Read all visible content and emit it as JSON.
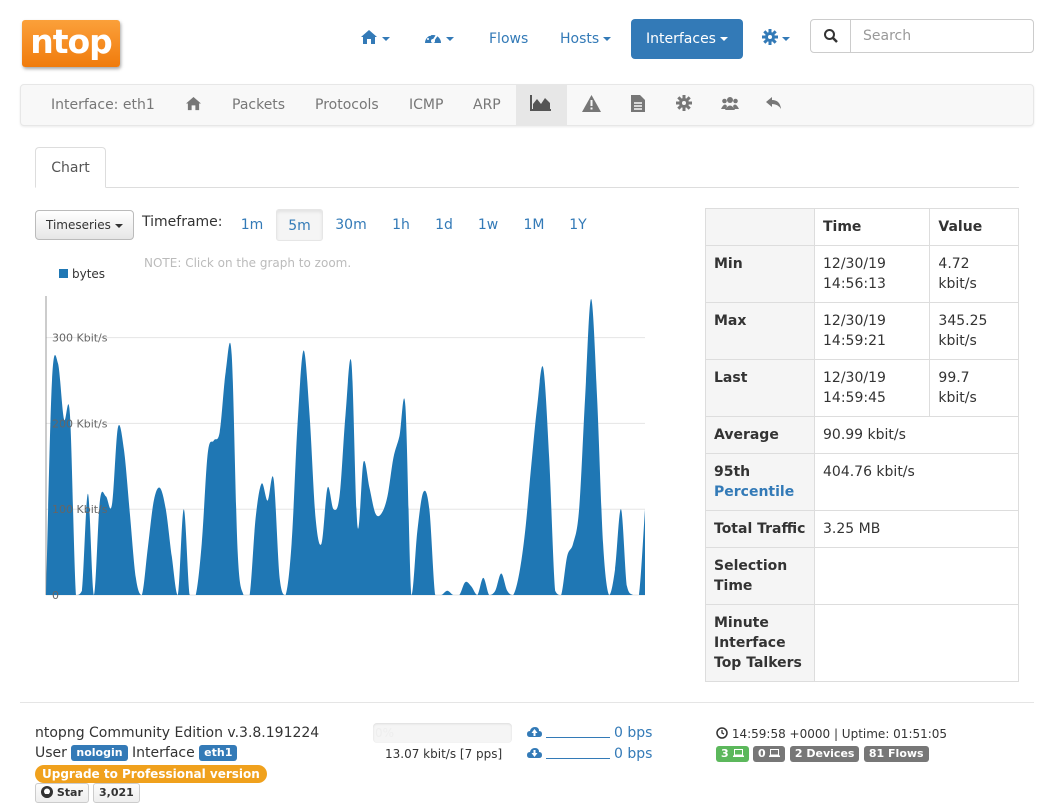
{
  "app": {
    "logo_text": "ntop"
  },
  "navbar": {
    "flows": "Flows",
    "hosts": "Hosts",
    "interfaces": "Interfaces",
    "search_placeholder": "Search"
  },
  "subnav": {
    "interface_label": "Interface: eth1",
    "packets": "Packets",
    "protocols": "Protocols",
    "icmp": "ICMP",
    "arp": "ARP"
  },
  "tabs": {
    "chart": "Chart"
  },
  "controls": {
    "timeseries": "Timeseries",
    "timeframe_label": "Timeframe:",
    "timeframes": [
      "1m",
      "5m",
      "30m",
      "1h",
      "1d",
      "1w",
      "1M",
      "1Y"
    ],
    "active_timeframe": "5m",
    "note": "NOTE: Click on the graph to zoom."
  },
  "chart_data": {
    "type": "area",
    "series": [
      {
        "name": "bytes",
        "color": "#1f77b4",
        "values": [
          0,
          250,
          270,
          205,
          210,
          0,
          5,
          118,
          0,
          110,
          115,
          105,
          195,
          170,
          95,
          20,
          0,
          55,
          110,
          125,
          100,
          45,
          0,
          100,
          0,
          0,
          60,
          165,
          180,
          190,
          260,
          280,
          50,
          0,
          0,
          90,
          130,
          110,
          135,
          20,
          0,
          60,
          200,
          285,
          210,
          90,
          60,
          125,
          100,
          115,
          210,
          270,
          80,
          155,
          125,
          95,
          95,
          115,
          160,
          185,
          220,
          0,
          75,
          120,
          100,
          0,
          0,
          5,
          0,
          0,
          15,
          10,
          0,
          20,
          0,
          5,
          25,
          5,
          0,
          25,
          75,
          150,
          220,
          265,
          160,
          5,
          0,
          45,
          60,
          100,
          230,
          345,
          230,
          60,
          0,
          30,
          100,
          10,
          0,
          0,
          100
        ]
      }
    ],
    "y_ticks": [
      "0",
      "100 Kbit/s",
      "200 Kbit/s",
      "300 Kbit/s"
    ],
    "y_tick_values": [
      0,
      100,
      200,
      300
    ],
    "ylim": [
      0,
      345
    ],
    "legend": "top-left",
    "grid": true
  },
  "stats": {
    "headers": [
      "",
      "Time",
      "Value"
    ],
    "min_label": "Min",
    "min_time": "12/30/19 14:56:13",
    "min_value": "4.72 kbit/s",
    "max_label": "Max",
    "max_time": "12/30/19 14:59:21",
    "max_value": "345.25 kbit/s",
    "last_label": "Last",
    "last_time": "12/30/19 14:59:45",
    "last_value": "99.7 kbit/s",
    "average_label": "Average",
    "average_value": "90.99 kbit/s",
    "p95_label_a": "95th",
    "p95_label_b": "Percentile",
    "p95_value": "404.76 kbit/s",
    "total_label": "Total Traffic",
    "total_value": "3.25 MB",
    "selection_label": "Selection Time",
    "talkers_label": "Minute Interface Top Talkers"
  },
  "footer": {
    "edition": "ntopng Community Edition v.3.8.191224",
    "user_label": "User",
    "user_badge": "nologin",
    "interface_label": "Interface",
    "interface_badge": "eth1",
    "upgrade": "Upgrade to Professional version",
    "star": "Star",
    "star_count": "3,021",
    "progress_text": "0%",
    "throughput": "13.07 kbit/s [7 pps]",
    "upload_rate": "0 bps",
    "download_rate": "0 bps",
    "clock": "14:59:58 +0000 | Uptime: 01:51:05",
    "hosts_badge": "3",
    "devices_zero_badge": "0",
    "devices_badge": "2 Devices",
    "flows_badge": "81 Flows"
  }
}
